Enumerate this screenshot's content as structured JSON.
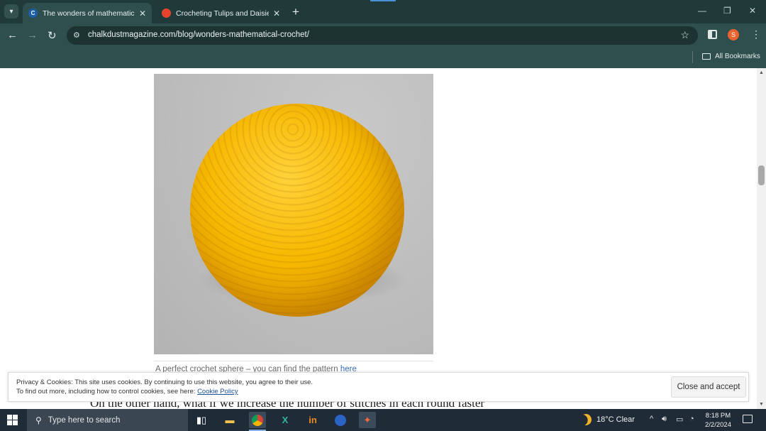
{
  "browser": {
    "tabs": [
      {
        "title": "The wonders of mathematical c",
        "favicon": "C",
        "active": true
      },
      {
        "title": "Crocheting Tulips and Daisies |",
        "favicon": "ravelry-icon",
        "active": false
      }
    ],
    "url": "chalkdustmagazine.com/blog/wonders-mathematical-crochet/",
    "profile_initial": "S",
    "bookmarks_folder": "All Bookmarks",
    "colors": {
      "chrome": "#1f3a39",
      "toolbar": "#2f4f4e",
      "profile": "#e8632f"
    }
  },
  "article": {
    "image_alt": "yellow crocheted sphere",
    "caption_text": "A perfect crochet sphere – you can find the pattern",
    "caption_link": "here",
    "body_text": "On the other hand, what if we increase the number of stitches in each round faster"
  },
  "cookie_banner": {
    "line1": "Privacy & Cookies: This site uses cookies. By continuing to use this website, you agree to their use.",
    "line2_prefix": "To find out more, including how to control cookies, see here:",
    "policy_link": "Cookie Policy",
    "accept_label": "Close and accept"
  },
  "taskbar": {
    "search_placeholder": "Type here to search",
    "weather": "18°C  Clear",
    "time": "8:18 PM",
    "date": "2/2/2024"
  }
}
